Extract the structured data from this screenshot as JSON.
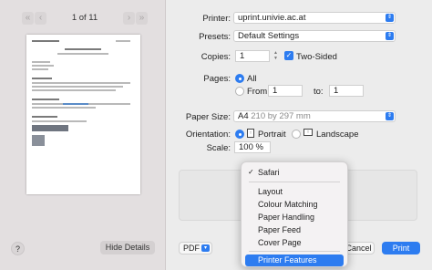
{
  "preview": {
    "nav_prev_first": "«",
    "nav_prev": "‹",
    "page_count": "1 of 11",
    "nav_next": "›",
    "nav_next_last": "»"
  },
  "footer": {
    "help": "?",
    "hide_details": "Hide Details",
    "pdf": "PDF",
    "cancel": "Cancel",
    "print": "Print"
  },
  "settings": {
    "printer_label": "Printer:",
    "printer_value": "uprint.univie.ac.at",
    "presets_label": "Presets:",
    "presets_value": "Default Settings",
    "copies_label": "Copies:",
    "copies_value": "1",
    "two_sided": "Two-Sided",
    "pages_label": "Pages:",
    "pages_all": "All",
    "pages_from": "From:",
    "pages_from_value": "1",
    "pages_to": "to:",
    "pages_to_value": "1",
    "paper_size_label": "Paper Size:",
    "paper_size_value": "A4",
    "paper_size_dims": "210 by 297 mm",
    "orientation_label": "Orientation:",
    "portrait": "Portrait",
    "landscape": "Landscape",
    "scale_label": "Scale:",
    "scale_value": "100 %"
  },
  "menu": {
    "selected": "Safari",
    "items": [
      "Layout",
      "Colour Matching",
      "Paper Handling",
      "Paper Feed",
      "Cover Page"
    ],
    "highlighted": "Printer Features"
  },
  "colors": {
    "accent": "#2d7cf0"
  }
}
